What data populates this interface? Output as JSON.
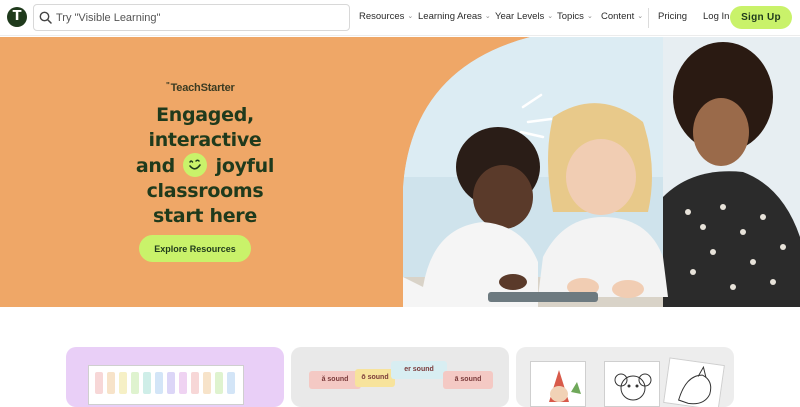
{
  "header": {
    "logo_glyph": "T",
    "search_placeholder": "Try \"Visible Learning\"",
    "nav": [
      {
        "label": "Resources",
        "has_dropdown": true
      },
      {
        "label": "Learning Areas",
        "has_dropdown": true
      },
      {
        "label": "Year Levels",
        "has_dropdown": true
      },
      {
        "label": "Topics",
        "has_dropdown": true
      },
      {
        "label": "Content",
        "has_dropdown": true
      }
    ],
    "pricing": "Pricing",
    "login": "Log In",
    "signup": "Sign Up",
    "chevron": "⌄"
  },
  "hero": {
    "brand": "TeachStarter",
    "brand_mark": "\"",
    "headline": {
      "line1": "Engaged,",
      "line2": "interactive",
      "line3_a": "and",
      "line3_b": "joyful",
      "line4": "classrooms",
      "line5": "start here"
    },
    "cta": "Explore Resources",
    "background_color": "#efa767",
    "accent_color": "#c9f26a",
    "text_color": "#1f3a1c"
  },
  "cards": {
    "card2_labels": [
      "ă sound",
      "ō sound",
      "er sound",
      "ā sound"
    ],
    "card1_color": "#e9cff7",
    "card2_color": "#e9e9e9",
    "card3_color": "#ededed"
  }
}
